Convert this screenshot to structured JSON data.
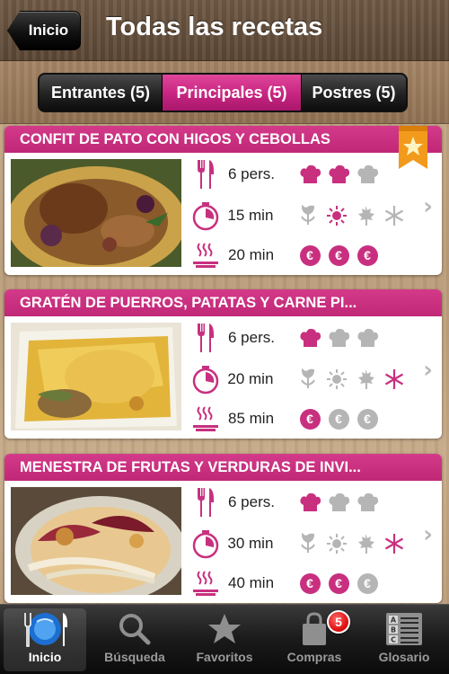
{
  "header": {
    "back_label": "Inicio",
    "title": "Todas las recetas"
  },
  "segments": [
    {
      "label": "Entrantes (5)",
      "active": false
    },
    {
      "label": "Principales (5)",
      "active": true
    },
    {
      "label": "Postres (5)",
      "active": false
    }
  ],
  "colors": {
    "accent": "#c8307f",
    "inactive_mark": "#b5b5b5",
    "dark_mark": "#c8307f"
  },
  "recipes": [
    {
      "title": "CONFIT DE PATO CON HIGOS Y CEBOLLAS",
      "favorite": true,
      "persons": "6 pers.",
      "prep_time": "15 min",
      "cook_time": "20 min",
      "difficulty_filled": 2,
      "seasons_active": [
        "summer"
      ],
      "cost_filled": 3
    },
    {
      "title": "GRATÉN DE PUERROS, PATATAS Y CARNE PI...",
      "favorite": false,
      "persons": "6 pers.",
      "prep_time": "20 min",
      "cook_time": "85 min",
      "difficulty_filled": 1,
      "seasons_active": [
        "winter"
      ],
      "cost_filled": 1
    },
    {
      "title": "MENESTRA DE FRUTAS Y VERDURAS DE INVI...",
      "favorite": false,
      "persons": "6 pers.",
      "prep_time": "30 min",
      "cook_time": "40 min",
      "difficulty_filled": 1,
      "seasons_active": [
        "winter"
      ],
      "cost_filled": 2
    }
  ],
  "tabbar": [
    {
      "label": "Inicio",
      "icon": "plate-icon",
      "active": true
    },
    {
      "label": "Búsqueda",
      "icon": "magnifier-icon",
      "active": false
    },
    {
      "label": "Favoritos",
      "icon": "star-icon",
      "active": false
    },
    {
      "label": "Compras",
      "icon": "shopping-bag-icon",
      "active": false,
      "badge": "5"
    },
    {
      "label": "Glosario",
      "icon": "glossary-icon",
      "active": false
    }
  ]
}
